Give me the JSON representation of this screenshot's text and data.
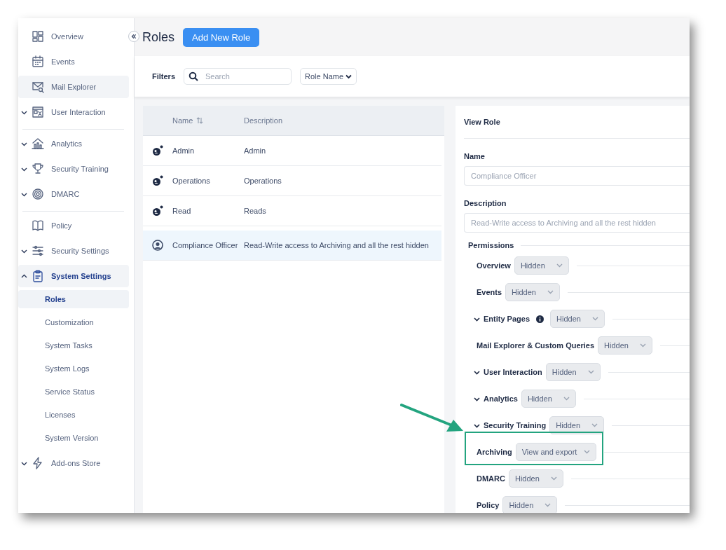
{
  "sidebar": {
    "sections": [
      {
        "items": [
          {
            "label": "Overview",
            "kind": "link",
            "selected": false,
            "hovered": false
          },
          {
            "label": "Events",
            "kind": "link",
            "selected": false,
            "hovered": false
          },
          {
            "label": "Mail Explorer",
            "kind": "link",
            "selected": false,
            "hovered": true
          },
          {
            "label": "User Interaction",
            "kind": "group",
            "expanded": false,
            "selected": false,
            "hovered": false
          }
        ]
      },
      {
        "items": [
          {
            "label": "Analytics",
            "kind": "group",
            "expanded": false,
            "selected": false,
            "hovered": false
          },
          {
            "label": "Security Training",
            "kind": "group",
            "expanded": false,
            "selected": false,
            "hovered": false
          },
          {
            "label": "DMARC",
            "kind": "group",
            "expanded": false,
            "selected": false,
            "hovered": false
          }
        ]
      },
      {
        "items": [
          {
            "label": "Policy",
            "kind": "link",
            "selected": false,
            "hovered": false
          },
          {
            "label": "Security Settings",
            "kind": "group",
            "expanded": false,
            "selected": false,
            "hovered": false
          },
          {
            "label": "System Settings",
            "kind": "group",
            "expanded": true,
            "selected": true,
            "hovered": false,
            "children": [
              {
                "label": "Roles",
                "selected": true
              },
              {
                "label": "Customization",
                "selected": false
              },
              {
                "label": "System Tasks",
                "selected": false
              },
              {
                "label": "System Logs",
                "selected": false
              },
              {
                "label": "Service Status",
                "selected": false
              },
              {
                "label": "Licenses",
                "selected": false
              },
              {
                "label": "System Version",
                "selected": false
              }
            ]
          },
          {
            "label": "Add-ons Store",
            "kind": "group",
            "expanded": false,
            "selected": false,
            "hovered": false
          }
        ]
      }
    ]
  },
  "header": {
    "title": "Roles",
    "button": "Add New Role"
  },
  "filters": {
    "label": "Filters",
    "search_placeholder": "Search",
    "dropdown": "Role Name"
  },
  "table": {
    "columns": [
      "Name",
      "Description"
    ],
    "rows": [
      {
        "kind": "system",
        "name": "Admin",
        "description": "Admin",
        "selected": false
      },
      {
        "kind": "system",
        "name": "Operations",
        "description": "Operations",
        "selected": false
      },
      {
        "kind": "system",
        "name": "Read",
        "description": "Reads",
        "selected": false
      },
      {
        "kind": "custom",
        "name": "Compliance Officer",
        "description": "Read-Write access to Archiving and all the rest hidden",
        "selected": true
      }
    ]
  },
  "detail": {
    "title": "View Role",
    "name_label": "Name",
    "name_value": "Compliance Officer",
    "description_label": "Description",
    "description_value": "Read-Write access to Archiving and all the rest hidden",
    "permissions_label": "Permissions",
    "permissions": [
      {
        "label": "Overview",
        "value": "Hidden",
        "expandable": false,
        "info": false,
        "highlighted": false
      },
      {
        "label": "Events",
        "value": "Hidden",
        "expandable": false,
        "info": false,
        "highlighted": false
      },
      {
        "label": "Entity Pages",
        "value": "Hidden",
        "expandable": true,
        "info": true,
        "highlighted": false
      },
      {
        "label": "Mail Explorer & Custom Queries",
        "value": "Hidden",
        "expandable": false,
        "info": false,
        "highlighted": false
      },
      {
        "label": "User Interaction",
        "value": "Hidden",
        "expandable": true,
        "info": false,
        "highlighted": false
      },
      {
        "label": "Analytics",
        "value": "Hidden",
        "expandable": true,
        "info": false,
        "highlighted": false
      },
      {
        "label": "Security Training",
        "value": "Hidden",
        "expandable": true,
        "info": false,
        "highlighted": false
      },
      {
        "label": "Archiving",
        "value": "View and export",
        "expandable": false,
        "info": false,
        "highlighted": true
      },
      {
        "label": "DMARC",
        "value": "Hidden",
        "expandable": false,
        "info": false,
        "highlighted": false
      },
      {
        "label": "Policy",
        "value": "Hidden",
        "expandable": false,
        "info": false,
        "highlighted": false
      }
    ]
  }
}
